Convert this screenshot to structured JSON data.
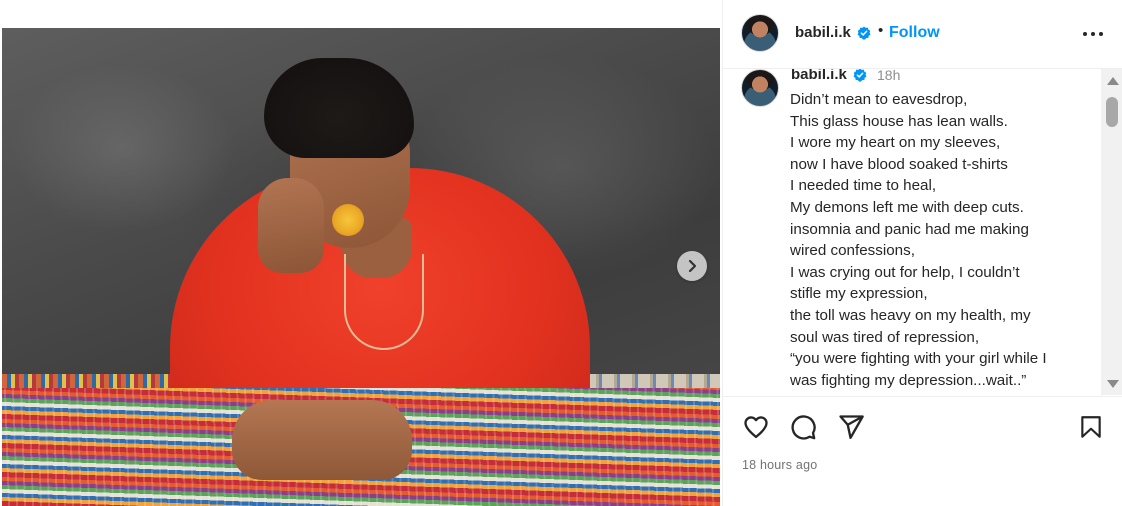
{
  "post": {
    "username": "babil.i.k",
    "follow_label": "Follow",
    "separator": "•",
    "caption_time": "18h",
    "caption_lines": [
      "Didn’t mean to eavesdrop,",
      "This glass house has lean walls.",
      "I wore my heart on my sleeves,",
      "now I have blood soaked t-shirts",
      "I needed time to heal,",
      "My demons left me with deep cuts.",
      "insomnia and panic had me making",
      "wired confessions,",
      "I was crying out for help, I couldn’t",
      "stifle my expression,",
      "the toll was heavy on my health, my",
      "soul was tired of repression,",
      "“you were fighting with your girl while I",
      "was fighting my depression...wait..”"
    ],
    "timestamp": "18 hours ago"
  },
  "icons": {
    "verified": "verified-badge-icon",
    "more": "more-options-icon",
    "next": "chevron-right-icon",
    "like": "heart-icon",
    "comment": "comment-icon",
    "share": "share-icon",
    "save": "bookmark-icon"
  },
  "colors": {
    "accent": "#0095f6",
    "text": "#262626",
    "muted": "#737373",
    "divider": "#efefef"
  }
}
